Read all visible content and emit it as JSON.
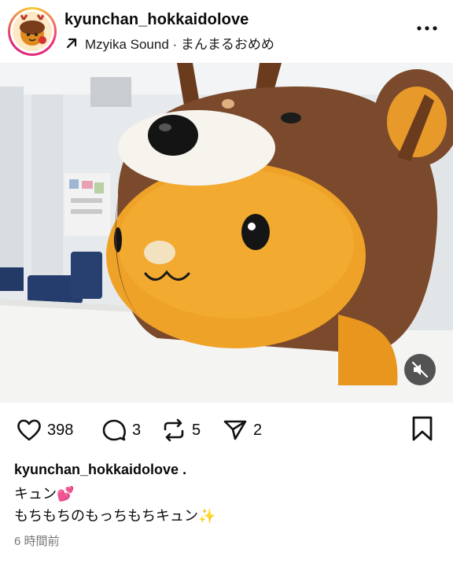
{
  "header": {
    "username": "kyunchan_hokkaidolove",
    "audio": "Mzyika Sound · まんまるおめめ",
    "more_icon": "more-dots-icon"
  },
  "post": {
    "image_description_icon": "mascot-photo",
    "mute_icon": "speaker-muted-icon"
  },
  "actions": {
    "likes": "398",
    "comments": "3",
    "reposts": "5",
    "shares": "2"
  },
  "caption": {
    "username": "kyunchan_hokkaidolove .",
    "line1": "キュン💕",
    "line2": "もちもちのもっちもちキュン✨",
    "timestamp": "6 時間前"
  },
  "colors": {
    "text": "#0a0a0a",
    "muted": "#777777",
    "avatar_ring": "#ee2a7b"
  }
}
